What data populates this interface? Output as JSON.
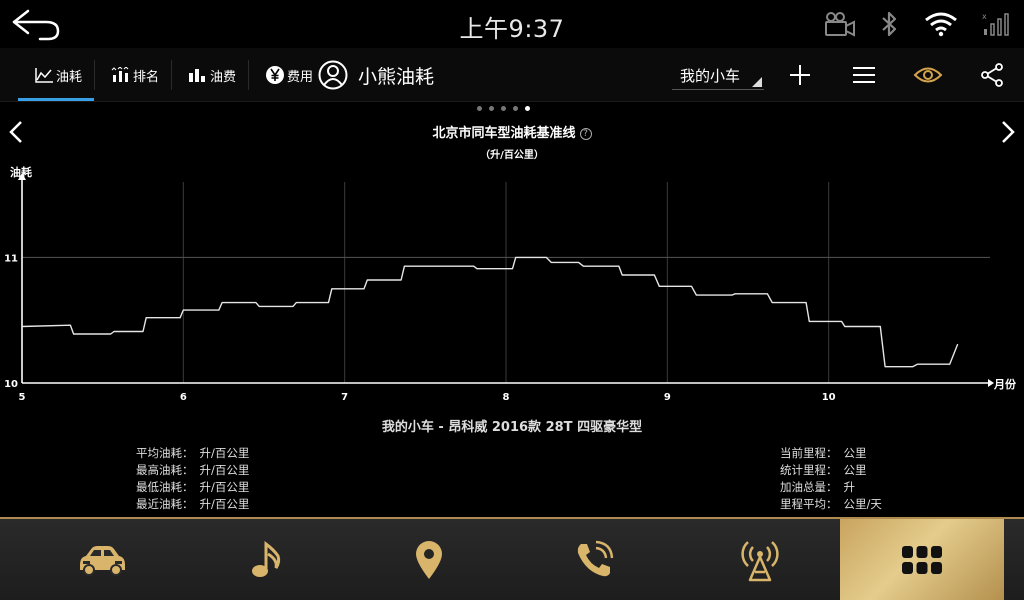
{
  "status_bar": {
    "time": "上午9:37",
    "icons": [
      "back-arrow-icon",
      "camera-icon",
      "bluetooth-icon",
      "wifi-icon",
      "signal-icon"
    ]
  },
  "tabs": [
    {
      "label": "油耗",
      "icon": "line-chart-icon",
      "active": true
    },
    {
      "label": "排名",
      "icon": "ranking-icon",
      "active": false
    },
    {
      "label": "油费",
      "icon": "bar-chart-icon",
      "active": false
    },
    {
      "label": "费用",
      "icon": "yen-icon",
      "active": false
    }
  ],
  "header": {
    "user_name": "小熊油耗",
    "car_select": "我的小车",
    "action_icons": [
      "add-icon",
      "menu-icon",
      "eye-icon",
      "share-icon"
    ],
    "accent_color": "#3aa0e6",
    "eye_color": "#d4a44a"
  },
  "pager": {
    "count": 5,
    "active": 4
  },
  "chart": {
    "title": "北京市同车型油耗基准线",
    "help": "?",
    "unit": "（升/百公里）"
  },
  "chart_data": {
    "type": "line",
    "ylabel": "油耗",
    "xlabel": "月份",
    "xlim": [
      5,
      11
    ],
    "ylim": [
      10,
      11.6
    ],
    "x_ticks": [
      "5",
      "6",
      "7",
      "8",
      "9",
      "10"
    ],
    "y_ticks": [
      "10",
      "11"
    ],
    "reference_line": 11,
    "series": [
      {
        "points": [
          [
            5.0,
            10.45
          ],
          [
            5.3,
            10.46
          ],
          [
            5.32,
            10.39
          ],
          [
            5.55,
            10.39
          ],
          [
            5.57,
            10.41
          ],
          [
            5.75,
            10.41
          ],
          [
            5.77,
            10.52
          ],
          [
            5.98,
            10.52
          ],
          [
            6.0,
            10.58
          ],
          [
            6.22,
            10.58
          ],
          [
            6.24,
            10.64
          ],
          [
            6.45,
            10.64
          ],
          [
            6.47,
            10.61
          ],
          [
            6.68,
            10.61
          ],
          [
            6.7,
            10.64
          ],
          [
            6.9,
            10.64
          ],
          [
            6.92,
            10.75
          ],
          [
            7.12,
            10.75
          ],
          [
            7.14,
            10.82
          ],
          [
            7.35,
            10.82
          ],
          [
            7.37,
            10.93
          ],
          [
            7.55,
            10.93
          ],
          [
            7.8,
            10.93
          ],
          [
            7.82,
            10.91
          ],
          [
            8.04,
            10.91
          ],
          [
            8.06,
            11.0
          ],
          [
            8.25,
            11.0
          ],
          [
            8.28,
            10.96
          ],
          [
            8.45,
            10.96
          ],
          [
            8.48,
            10.93
          ],
          [
            8.7,
            10.93
          ],
          [
            8.72,
            10.86
          ],
          [
            8.92,
            10.86
          ],
          [
            8.95,
            10.77
          ],
          [
            9.15,
            10.77
          ],
          [
            9.18,
            10.7
          ],
          [
            9.4,
            10.7
          ],
          [
            9.42,
            10.71
          ],
          [
            9.62,
            10.71
          ],
          [
            9.65,
            10.64
          ],
          [
            9.86,
            10.64
          ],
          [
            9.88,
            10.49
          ],
          [
            10.08,
            10.49
          ],
          [
            10.1,
            10.45
          ],
          [
            10.32,
            10.45
          ],
          [
            10.35,
            10.13
          ],
          [
            10.52,
            10.13
          ],
          [
            10.55,
            10.15
          ],
          [
            10.75,
            10.15
          ],
          [
            10.8,
            10.31
          ]
        ]
      }
    ]
  },
  "car_model": "我的小车 - 昂科威 2016款 28T 四驱豪华型",
  "stats_left": [
    {
      "label": "平均油耗：",
      "value": "升/百公里"
    },
    {
      "label": "最高油耗：",
      "value": "升/百公里"
    },
    {
      "label": "最低油耗：",
      "value": "升/百公里"
    },
    {
      "label": "最近油耗：",
      "value": "升/百公里"
    }
  ],
  "stats_right": [
    {
      "label": "当前里程：",
      "value": "公里"
    },
    {
      "label": "统计里程：",
      "value": "公里"
    },
    {
      "label": "加油总量：",
      "value": "升"
    },
    {
      "label": "里程平均：",
      "value": "公里/天"
    }
  ],
  "dock": [
    {
      "icon": "car-icon",
      "active": false
    },
    {
      "icon": "music-note-icon",
      "active": false
    },
    {
      "icon": "location-pin-icon",
      "active": false
    },
    {
      "icon": "phone-icon",
      "active": false
    },
    {
      "icon": "radio-antenna-icon",
      "active": false
    },
    {
      "icon": "apps-grid-icon",
      "active": true
    }
  ],
  "colors": {
    "dock_gold": "#d4b06a",
    "dock_icon": "#d9b56b"
  }
}
